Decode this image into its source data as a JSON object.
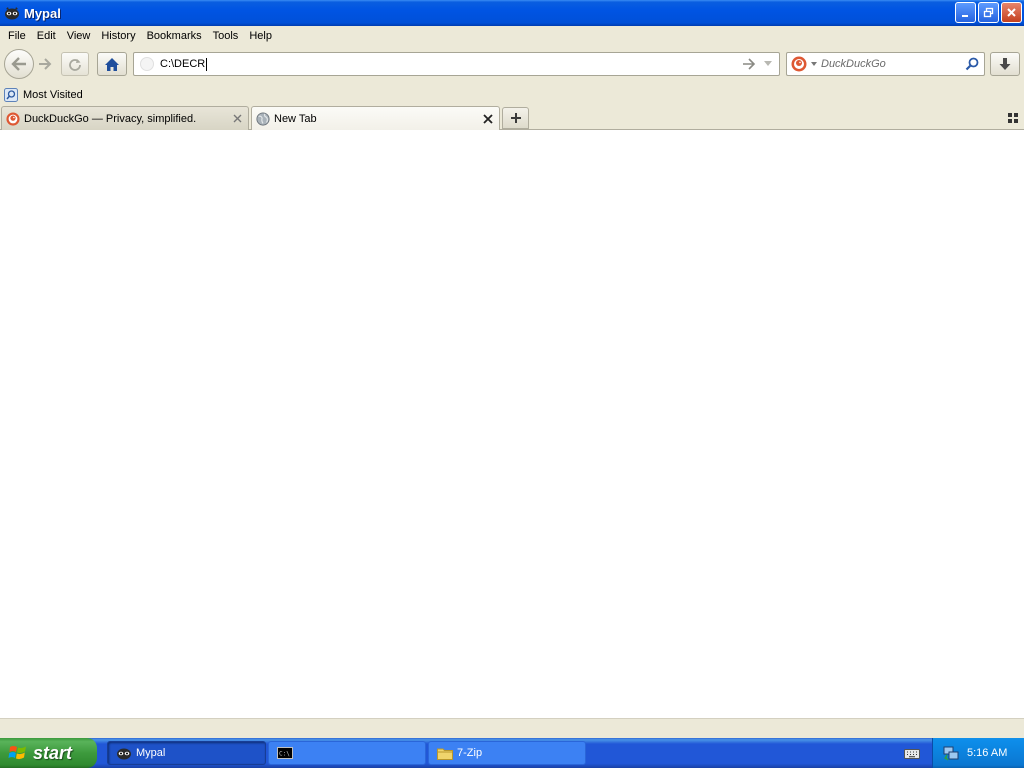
{
  "window": {
    "title": "Mypal",
    "icon": "mypal-raccoon-icon"
  },
  "menu": {
    "items": [
      "File",
      "Edit",
      "View",
      "History",
      "Bookmarks",
      "Tools",
      "Help"
    ]
  },
  "navigation": {
    "back_icon": "back-arrow-icon",
    "forward_icon": "forward-arrow-icon",
    "reload_icon": "reload-icon",
    "home_icon": "home-icon",
    "url_value": "C:\\DECR",
    "go_icon": "go-arrow-icon",
    "history_dropdown_icon": "chevron-down-icon",
    "search_engine_icon": "duckduckgo-icon",
    "search_placeholder": "DuckDuckGo",
    "search_icon": "magnifier-icon",
    "downloads_icon": "download-icon"
  },
  "bookmarks": {
    "items": [
      {
        "label": "Most Visited",
        "icon": "most-visited-icon"
      }
    ]
  },
  "tabs": [
    {
      "label": "DuckDuckGo — Privacy, simplified.",
      "icon": "duckduckgo-icon",
      "active": false
    },
    {
      "label": "New Tab",
      "icon": "globe-icon",
      "active": true
    }
  ],
  "taskbar": {
    "start_label": "start",
    "tasks": [
      {
        "label": "Mypal",
        "icon": "mypal-raccoon-icon",
        "active": true
      },
      {
        "label": "",
        "icon": "command-prompt-icon",
        "active": false
      },
      {
        "label": "7-Zip",
        "icon": "folder-icon",
        "active": false
      }
    ],
    "clock": "5:16 AM"
  },
  "colors": {
    "titlebar": "#0054e3",
    "taskbar": "#2157d7",
    "start": "#3d9a3d",
    "tray": "#0b77d1",
    "content": "#ffffff",
    "chrome": "#ece9d8"
  }
}
